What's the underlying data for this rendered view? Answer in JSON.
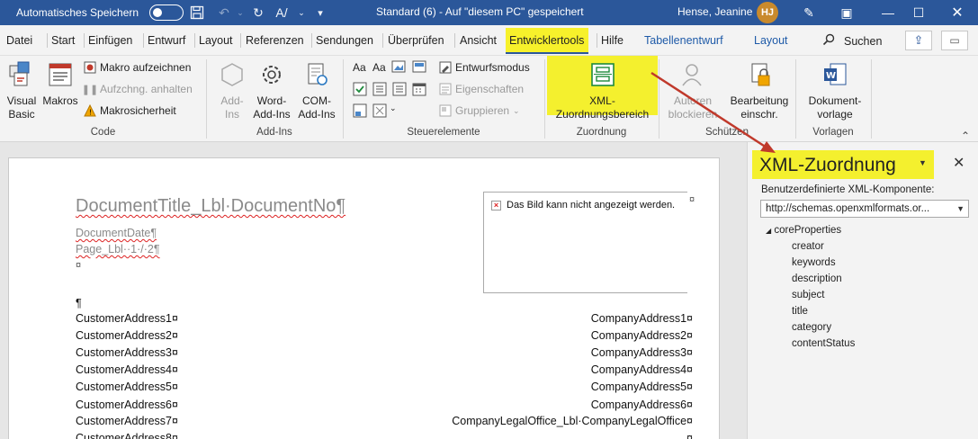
{
  "titlebar": {
    "autosave_label": "Automatisches Speichern",
    "doc_title": "Standard (6)  -  Auf \"diesem PC\" gespeichert",
    "user_name": "Hense, Jeanine",
    "user_initials": "HJ"
  },
  "menu": {
    "tabs": [
      "Datei",
      "Start",
      "Einfügen",
      "Entwurf",
      "Layout",
      "Referenzen",
      "Sendungen",
      "Überprüfen",
      "Ansicht",
      "Entwicklertools",
      "Hilfe",
      "Tabellenentwurf",
      "Layout"
    ],
    "active_tab": "Entwicklertools",
    "search_label": "Suchen"
  },
  "ribbon": {
    "code": {
      "group_label": "Code",
      "visual_basic": "Visual Basic",
      "visual_basic_l1": "Visual",
      "visual_basic_l2": "Basic",
      "macros": "Makros",
      "record_macro": "Makro aufzeichnen",
      "pause_recording": "Aufzchng. anhalten",
      "macro_security": "Makrosicherheit"
    },
    "addins": {
      "group_label": "Add-Ins",
      "addins_l1": "Add-",
      "addins_l2": "Ins",
      "word_addins_l1": "Word-",
      "word_addins_l2": "Add-Ins",
      "com_addins_l1": "COM-",
      "com_addins_l2": "Add-Ins"
    },
    "controls": {
      "group_label": "Steuerelemente",
      "design_mode": "Entwurfsmodus",
      "properties": "Eigenschaften",
      "group": "Gruppieren"
    },
    "mapping": {
      "group_label": "Zuordnung",
      "xml_pane_l1": "XML-",
      "xml_pane_l2": "Zuordnungsbereich"
    },
    "protect": {
      "group_label": "Schützen",
      "block_authors_l1": "Autoren",
      "block_authors_l2": "blockieren",
      "restrict_editing_l1": "Bearbeitung",
      "restrict_editing_l2": "einschr."
    },
    "templates": {
      "group_label": "Vorlagen",
      "doc_template_l1": "Dokument-",
      "doc_template_l2": "vorlage"
    }
  },
  "document": {
    "title_line": "DocumentTitle_Lbl·DocumentNo¶",
    "date_line": "DocumentDate¶",
    "page_line": "Page_Lbl··1·/·2¶",
    "cell_mark": "¤",
    "empty_para": "¶",
    "image_error": "Das Bild kann nicht angezeigt werden.",
    "customer_lines": [
      "CustomerAddress1¤",
      "CustomerAddress2¤",
      "CustomerAddress3¤",
      "CustomerAddress4¤",
      "CustomerAddress5¤",
      "CustomerAddress6¤",
      "CustomerAddress7¤",
      "CustomerAddress8¤"
    ],
    "company_lines": [
      "CompanyAddress1¤",
      "CompanyAddress2¤",
      "CompanyAddress3¤",
      "CompanyAddress4¤",
      "CompanyAddress5¤",
      "CompanyAddress6¤",
      "CompanyLegalOffice_Lbl·CompanyLegalOffice¤",
      "¤"
    ]
  },
  "xml_pane": {
    "title": "XML-Zuordnung",
    "label": "Benutzerdefinierte XML-Komponente:",
    "selected_part": "http://schemas.openxmlformats.or...",
    "tree_root": "coreProperties",
    "tree_items": [
      "creator",
      "keywords",
      "description",
      "subject",
      "title",
      "category",
      "contentStatus"
    ]
  },
  "colors": {
    "titlebar": "#2b579a",
    "highlight": "#f4f02e",
    "arrow": "#c0392b"
  }
}
